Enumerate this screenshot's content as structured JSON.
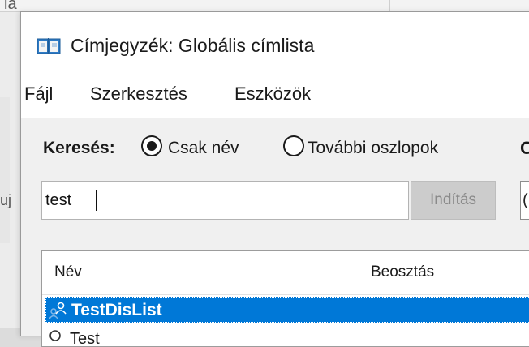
{
  "background": {
    "fragment_top": "la",
    "fragment_left": "uj"
  },
  "dialog": {
    "title": "Címjegyzék: Globális címlista",
    "title_icon": "address-book-icon"
  },
  "menu": {
    "items": [
      "Fájl",
      "Szerkesztés",
      "Eszközök"
    ]
  },
  "search": {
    "label": "Keresés:",
    "options": [
      {
        "label": "Csak név",
        "selected": true
      },
      {
        "label": "További oszlopok",
        "selected": false
      }
    ],
    "clipped_label": "C",
    "input_value": "test",
    "go_label": "Indítás",
    "right_field_fragment": "("
  },
  "list": {
    "columns": [
      "Név",
      "Beosztás"
    ],
    "rows": [
      {
        "name": "TestDisList",
        "icon": "distribution-list-icon",
        "selected": true
      },
      {
        "name": "Test",
        "icon": "contact-icon",
        "selected": false
      }
    ]
  },
  "colors": {
    "selection": "#0078d7",
    "dialog_bg": "#f0f0f0"
  }
}
